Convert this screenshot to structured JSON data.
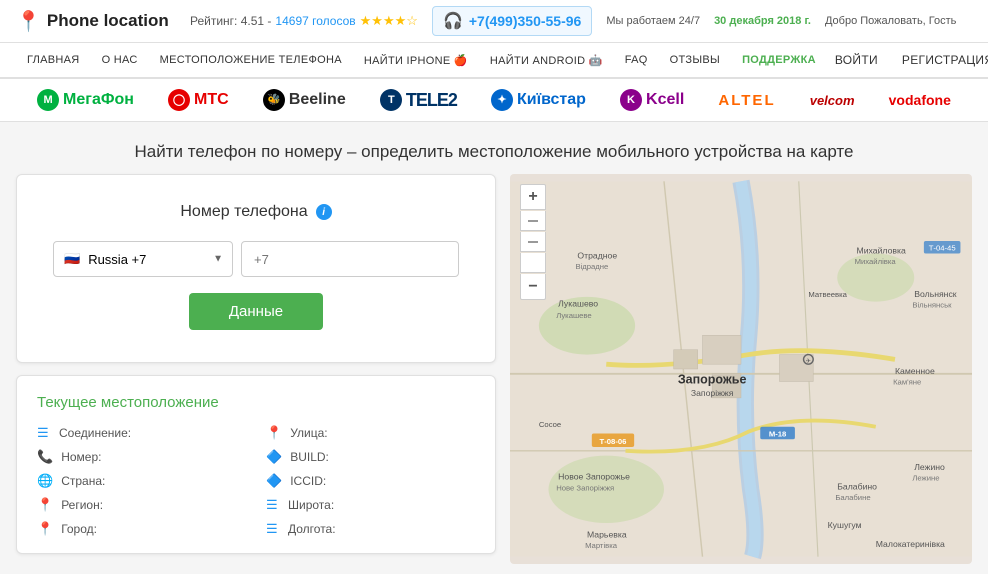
{
  "header": {
    "logo_text": "Phone location",
    "rating_label": "Рейтинг: 4.51 -",
    "rating_votes": "14697 голосов",
    "phone_number": "+7(499)350-55-96",
    "work_hours": "Мы работаем 24/7",
    "date": "30 декабря 2018 г.",
    "greeting": "Добро Пожаловать, Гость"
  },
  "nav": {
    "items": [
      {
        "label": "ГЛАВНАЯ",
        "active": false
      },
      {
        "label": "О НАС",
        "active": false
      },
      {
        "label": "МЕСТОПОЛОЖЕНИЕ ТЕЛЕФОНА",
        "active": false
      },
      {
        "label": "НАЙТИ IPHONE",
        "active": false
      },
      {
        "label": "НАЙТИ ANDROID",
        "active": false
      },
      {
        "label": "FAQ",
        "active": false
      },
      {
        "label": "ОТЗЫВЫ",
        "active": false
      },
      {
        "label": "ПОДДЕРЖКА",
        "active": true,
        "support": true
      }
    ],
    "login": "Войти",
    "register": "Регистрация"
  },
  "carriers": [
    {
      "name": "МегаФон",
      "class": "megafon"
    },
    {
      "name": "МТС",
      "class": "mts"
    },
    {
      "name": "Beeline",
      "class": "beeline"
    },
    {
      "name": "TELE2",
      "class": "tele2"
    },
    {
      "name": "Київстар",
      "class": "kyivstar"
    },
    {
      "name": "Kcell",
      "class": "kcell"
    },
    {
      "name": "ALTEL",
      "class": "altel"
    },
    {
      "name": "velcom",
      "class": "velcom"
    },
    {
      "name": "vodafone",
      "class": "vodafone"
    }
  ],
  "headline": "Найти телефон по номеру – определить местоположение мобильного устройства на карте",
  "form": {
    "title": "Номер телефона",
    "country_default": "Russia +7",
    "phone_placeholder": "+7",
    "submit_label": "Данные"
  },
  "location_section": {
    "title": "Текущее местоположение",
    "fields_left": [
      {
        "icon": "≡",
        "icon_class": "blue",
        "label": "Соединение:"
      },
      {
        "icon": "📞",
        "icon_class": "",
        "label": "Номер:"
      },
      {
        "icon": "🌐",
        "icon_class": "",
        "label": "Страна:"
      },
      {
        "icon": "📍",
        "icon_class": "",
        "label": "Регион:"
      },
      {
        "icon": "🏙",
        "icon_class": "",
        "label": "Город:"
      }
    ],
    "fields_right": [
      {
        "icon": "📍",
        "icon_class": "",
        "label": "Улица:"
      },
      {
        "icon": "🔷",
        "icon_class": "blue",
        "label": "BUILD:"
      },
      {
        "icon": "🔷",
        "icon_class": "blue",
        "label": "ICCID:"
      },
      {
        "icon": "≡",
        "icon_class": "blue",
        "label": "Широта:"
      },
      {
        "icon": "≡",
        "icon_class": "blue",
        "label": "Долгота:"
      }
    ]
  },
  "map": {
    "zoom_in_label": "+",
    "zoom_out_label": "−",
    "label_zaporozhye": "Запорожье"
  }
}
